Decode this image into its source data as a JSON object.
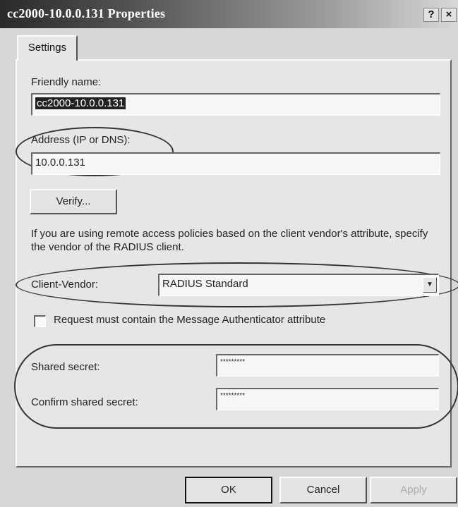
{
  "window": {
    "title": "cc2000-10.0.0.131 Properties",
    "help_glyph": "?",
    "close_glyph": "×"
  },
  "tabs": [
    {
      "label": "Settings"
    }
  ],
  "form": {
    "friendly_name_label": "Friendly name:",
    "friendly_name_value": "cc2000-10.0.0.131",
    "address_label": "Address (IP or DNS):",
    "address_value": "10.0.0.131",
    "verify_label": "Verify...",
    "vendor_help_text": "If you are using remote access policies based on the client vendor's attribute, specify the vendor of the RADIUS client.",
    "client_vendor_label": "Client-Vendor:",
    "client_vendor_value": "RADIUS Standard",
    "dropdown_arrow": "▼",
    "authenticator_checkbox_label": "Request must contain the Message Authenticator attribute",
    "authenticator_checked": false,
    "shared_secret_label": "Shared secret:",
    "shared_secret_value": "*********",
    "confirm_secret_label": "Confirm shared secret:",
    "confirm_secret_value": "*********"
  },
  "buttons": {
    "ok": "OK",
    "cancel": "Cancel",
    "apply": "Apply"
  }
}
